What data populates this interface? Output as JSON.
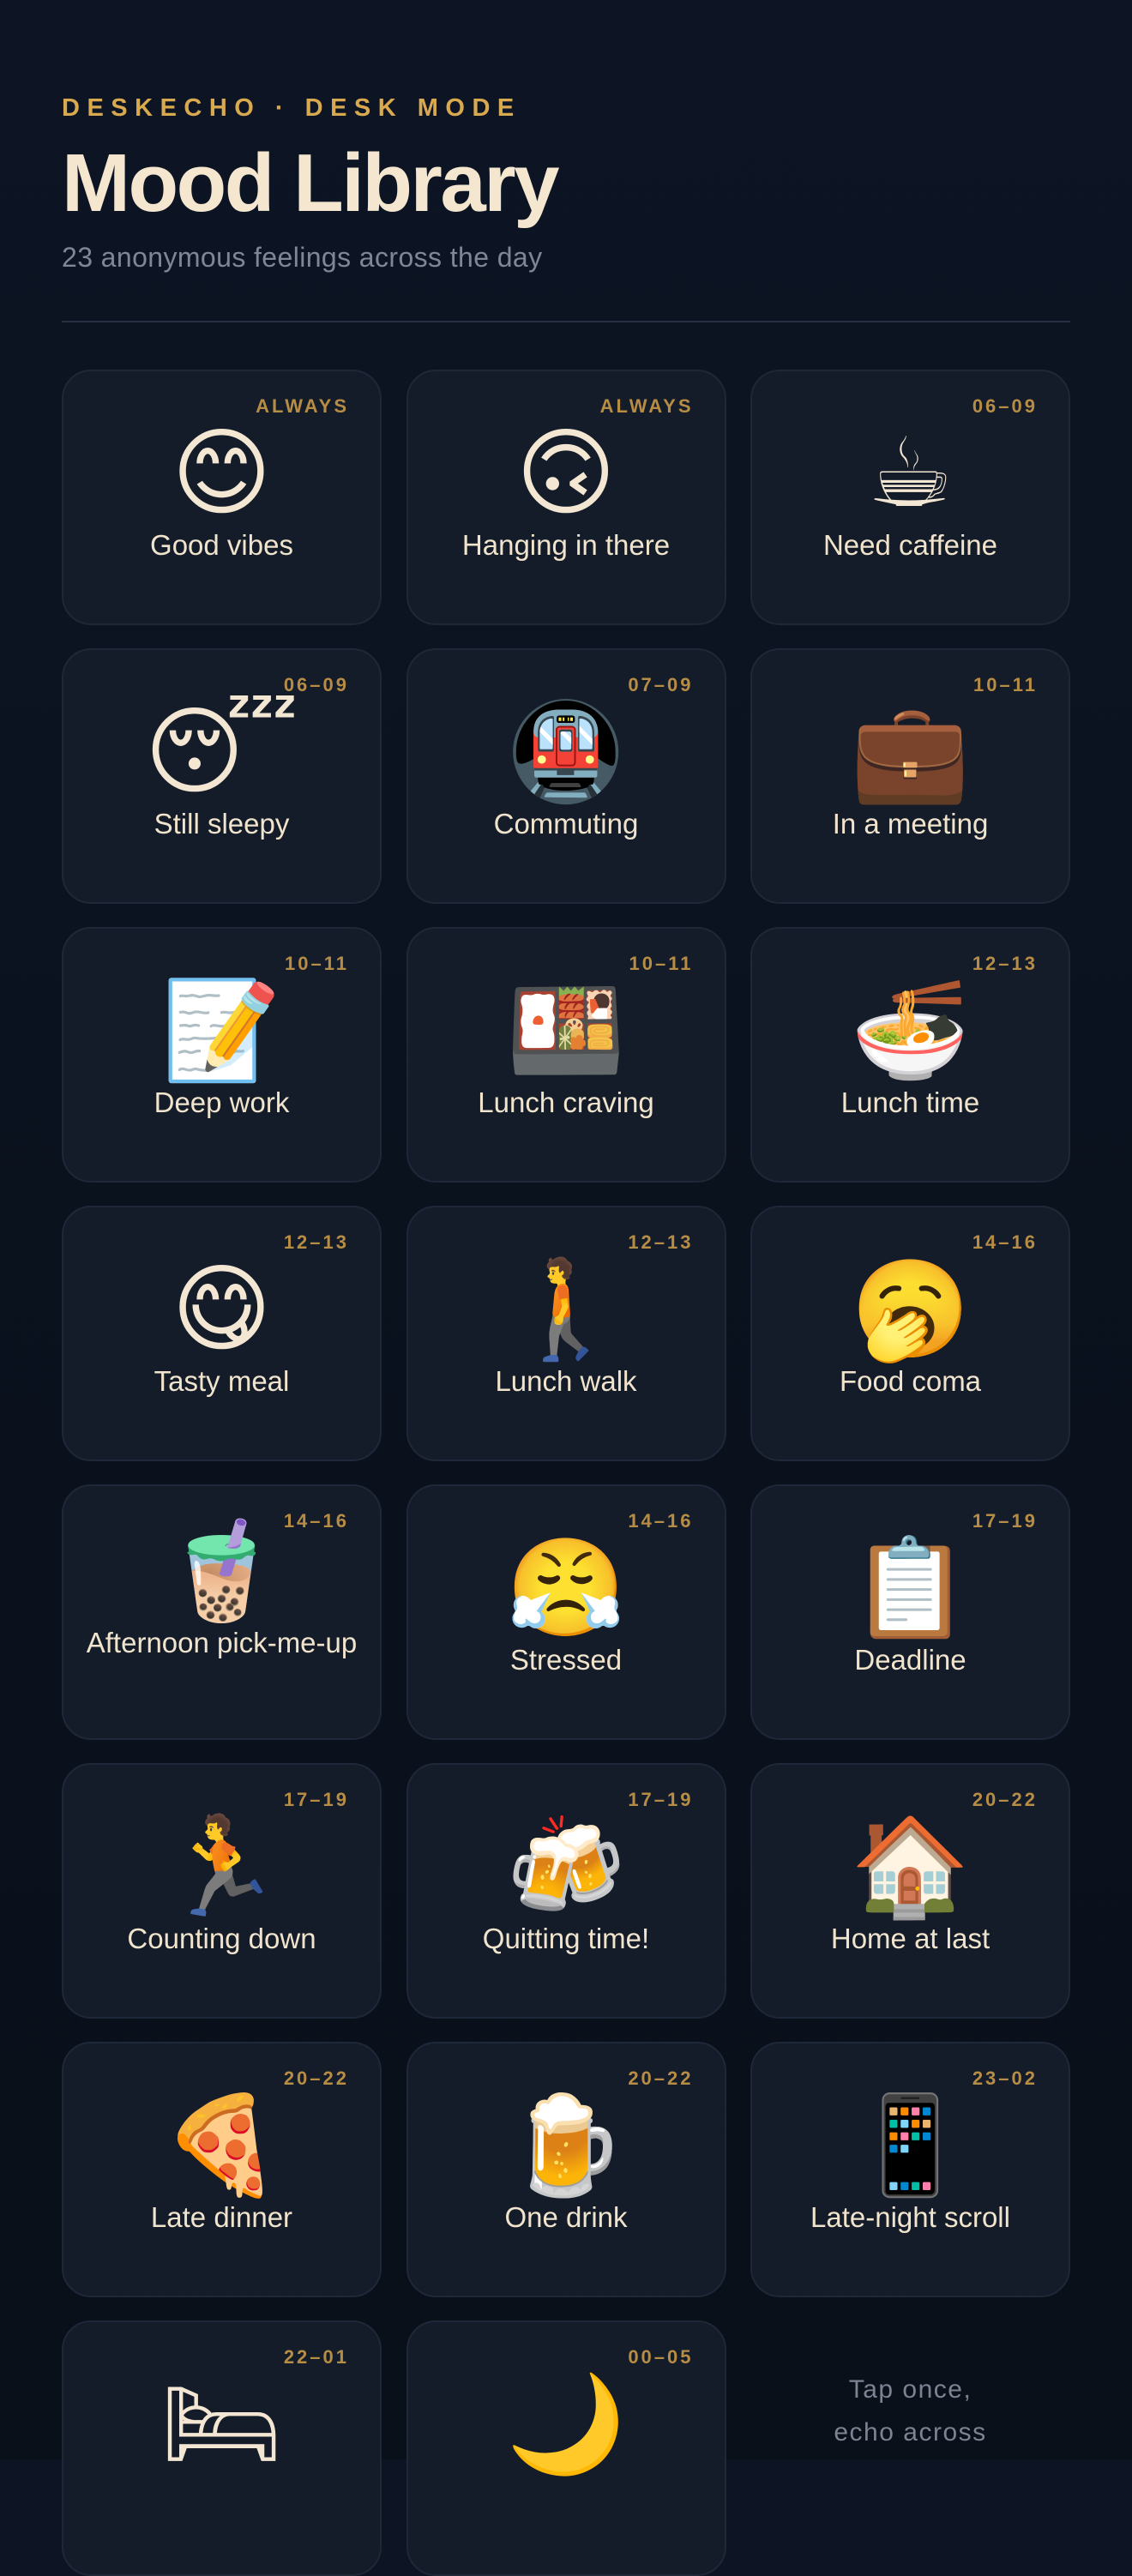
{
  "header": {
    "eyebrow": "DESKECHO · DESK MODE",
    "title": "Mood Library",
    "subtitle": "23 anonymous feelings across the day"
  },
  "moods": [
    {
      "label": "Good vibes",
      "time": "ALWAYS",
      "icon": "😊",
      "icon_name": "smiling-face-icon"
    },
    {
      "label": "Hanging in there",
      "time": "ALWAYS",
      "icon": "🙃",
      "icon_name": "upside-down-face-icon"
    },
    {
      "label": "Need caffeine",
      "time": "06–09",
      "icon": "☕",
      "icon_name": "coffee-cup-icon"
    },
    {
      "label": "Still sleepy",
      "time": "06–09",
      "icon": "😴",
      "icon_name": "sleeping-face-icon"
    },
    {
      "label": "Commuting",
      "time": "07–09",
      "icon": "🚇",
      "icon_name": "train-icon"
    },
    {
      "label": "In a meeting",
      "time": "10–11",
      "icon": "💼",
      "icon_name": "briefcase-icon"
    },
    {
      "label": "Deep work",
      "time": "10–11",
      "icon": "📝",
      "icon_name": "memo-pencil-icon"
    },
    {
      "label": "Lunch craving",
      "time": "10–11",
      "icon": "🍱",
      "icon_name": "bento-box-icon"
    },
    {
      "label": "Lunch time",
      "time": "12–13",
      "icon": "🍜",
      "icon_name": "noodle-bowl-icon"
    },
    {
      "label": "Tasty meal",
      "time": "12–13",
      "icon": "😋",
      "icon_name": "yum-face-icon"
    },
    {
      "label": "Lunch walk",
      "time": "12–13",
      "icon": "🚶",
      "icon_name": "walking-person-icon"
    },
    {
      "label": "Food coma",
      "time": "14–16",
      "icon": "🥱",
      "icon_name": "yawning-face-icon"
    },
    {
      "label": "Afternoon pick-me-up",
      "time": "14–16",
      "icon": "🧋",
      "icon_name": "bubble-tea-icon"
    },
    {
      "label": "Stressed",
      "time": "14–16",
      "icon": "😤",
      "icon_name": "steaming-face-icon"
    },
    {
      "label": "Deadline",
      "time": "17–19",
      "icon": "📋",
      "icon_name": "clipboard-icon"
    },
    {
      "label": "Counting down",
      "time": "17–19",
      "icon": "🏃",
      "icon_name": "running-person-icon"
    },
    {
      "label": "Quitting time!",
      "time": "17–19",
      "icon": "🍻",
      "icon_name": "clinking-beers-icon"
    },
    {
      "label": "Home at last",
      "time": "20–22",
      "icon": "🏠",
      "icon_name": "house-icon"
    },
    {
      "label": "Late dinner",
      "time": "20–22",
      "icon": "🍕",
      "icon_name": "pizza-icon"
    },
    {
      "label": "One drink",
      "time": "20–22",
      "icon": "🍺",
      "icon_name": "beer-mug-icon"
    },
    {
      "label": "Late-night scroll",
      "time": "23–02",
      "icon": "📱",
      "icon_name": "phone-icon"
    },
    {
      "label": "",
      "time": "22–01",
      "icon": "🛏",
      "icon_name": "bed-icon"
    },
    {
      "label": "",
      "time": "00–05",
      "icon": "🌙",
      "icon_name": "crescent-moon-icon"
    }
  ],
  "hint": {
    "line1": "Tap once,",
    "line2": "echo across"
  }
}
